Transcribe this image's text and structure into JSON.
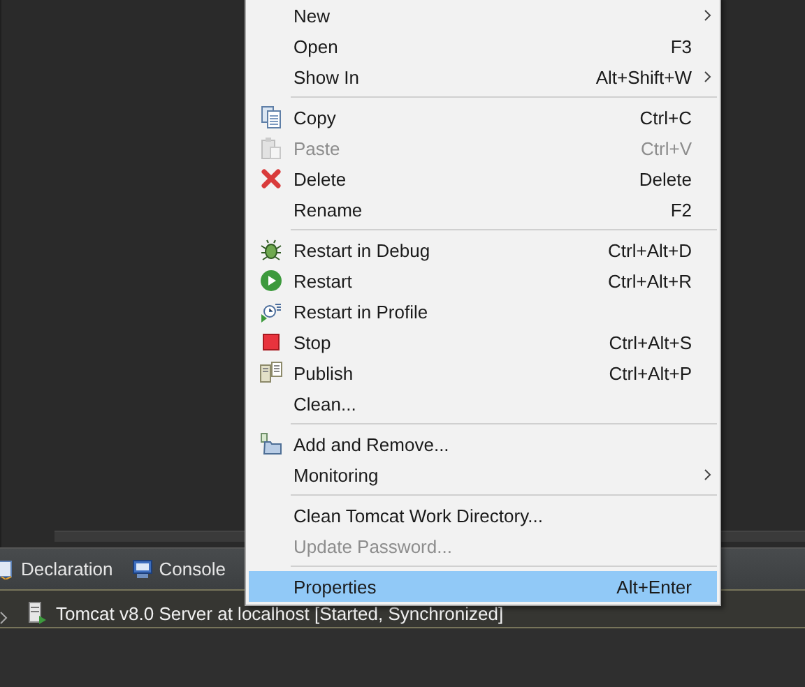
{
  "views": {
    "tabs": [
      {
        "label": "Declaration",
        "selected": false
      },
      {
        "label": "Console",
        "selected": false
      }
    ]
  },
  "servers": {
    "rows": [
      {
        "label": "Tomcat v8.0 Server at localhost  [Started, Synchronized]",
        "expanded": false
      }
    ]
  },
  "context_menu": {
    "items": [
      {
        "kind": "item",
        "label": "New",
        "submenu": true,
        "disabled": false,
        "selected": false
      },
      {
        "kind": "item",
        "label": "Open",
        "shortcut": "F3",
        "submenu": false,
        "disabled": false,
        "selected": false
      },
      {
        "kind": "item",
        "label": "Show In",
        "shortcut": "Alt+Shift+W",
        "submenu": true,
        "disabled": false,
        "selected": false
      },
      {
        "kind": "separator"
      },
      {
        "kind": "item",
        "label": "Copy",
        "shortcut": "Ctrl+C",
        "submenu": false,
        "disabled": false,
        "selected": false
      },
      {
        "kind": "item",
        "label": "Paste",
        "shortcut": "Ctrl+V",
        "submenu": false,
        "disabled": true,
        "selected": false
      },
      {
        "kind": "item",
        "label": "Delete",
        "shortcut": "Delete",
        "submenu": false,
        "disabled": false,
        "selected": false
      },
      {
        "kind": "item",
        "label": "Rename",
        "shortcut": "F2",
        "submenu": false,
        "disabled": false,
        "selected": false
      },
      {
        "kind": "separator"
      },
      {
        "kind": "item",
        "label": "Restart in Debug",
        "shortcut": "Ctrl+Alt+D",
        "submenu": false,
        "disabled": false,
        "selected": false
      },
      {
        "kind": "item",
        "label": "Restart",
        "shortcut": "Ctrl+Alt+R",
        "submenu": false,
        "disabled": false,
        "selected": false
      },
      {
        "kind": "item",
        "label": "Restart in Profile",
        "submenu": false,
        "disabled": false,
        "selected": false
      },
      {
        "kind": "item",
        "label": "Stop",
        "shortcut": "Ctrl+Alt+S",
        "submenu": false,
        "disabled": false,
        "selected": false
      },
      {
        "kind": "item",
        "label": "Publish",
        "shortcut": "Ctrl+Alt+P",
        "submenu": false,
        "disabled": false,
        "selected": false
      },
      {
        "kind": "item",
        "label": "Clean...",
        "submenu": false,
        "disabled": false,
        "selected": false
      },
      {
        "kind": "separator"
      },
      {
        "kind": "item",
        "label": "Add and Remove...",
        "submenu": false,
        "disabled": false,
        "selected": false
      },
      {
        "kind": "item",
        "label": "Monitoring",
        "submenu": true,
        "disabled": false,
        "selected": false
      },
      {
        "kind": "separator"
      },
      {
        "kind": "item",
        "label": "Clean Tomcat Work Directory...",
        "submenu": false,
        "disabled": false,
        "selected": false
      },
      {
        "kind": "item",
        "label": "Update Password...",
        "submenu": false,
        "disabled": true,
        "selected": false
      },
      {
        "kind": "separator"
      },
      {
        "kind": "item",
        "label": "Properties",
        "shortcut": "Alt+Enter",
        "submenu": false,
        "disabled": false,
        "selected": true
      }
    ]
  }
}
